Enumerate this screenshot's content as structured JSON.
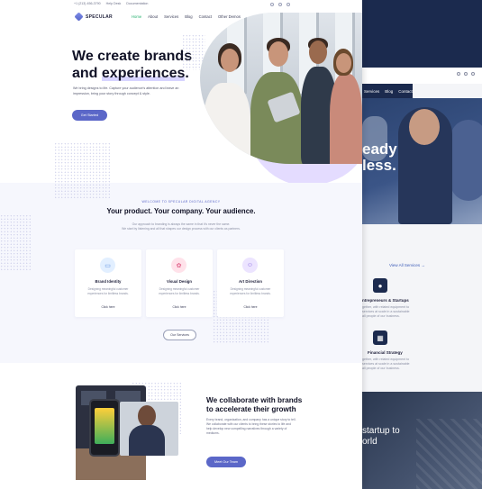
{
  "topbar": {
    "items": [
      "+1 (213) 456-3790",
      "Help Desk",
      "Documentation"
    ]
  },
  "brand": {
    "name": "SPECULAR"
  },
  "nav": {
    "items": [
      "Home",
      "About",
      "Services",
      "Blog",
      "Contact",
      "Other Demos"
    ],
    "active_index": 0
  },
  "hero": {
    "title_line1": "We create brands",
    "title_line2_prefix": "and ",
    "title_line2_underlined": "experiences",
    "title_line2_suffix": ".",
    "subtitle": "We bring designs to life. Capture your audience's attention and leave an impression, bring your story through concept & style.",
    "cta": "Get Started"
  },
  "services": {
    "eyebrow": "WELCOME TO SPECULAR DIGITAL AGENCY",
    "title": "Your product. Your company. Your audience.",
    "subtitle_line1": "Our approach to branding is always the same in that it's never the same.",
    "subtitle_line2": "We start by listening and all that shapes our design process with our clients as partners.",
    "cards": [
      {
        "icon": "monitor-icon",
        "title": "Brand Identity",
        "text": "Designing meaningful customer experiences for limitless brands.",
        "link": "Click here"
      },
      {
        "icon": "brush-icon",
        "title": "Visual Design",
        "text": "Designing meaningful customer experiences for limitless brands.",
        "link": "Click here"
      },
      {
        "icon": "smile-icon",
        "title": "Art Direction",
        "text": "Designing meaningful customer experiences for limitless brands.",
        "link": "Click here"
      }
    ],
    "cta": "Our Services"
  },
  "collab": {
    "title_line1": "We collaborate with brands",
    "title_line2": "to accelerate their growth",
    "text": "Every brand, organization, and company has a unique story to tell. We collaborate with our clients to bring these stories to life and help develop new compelling narratives through a variety of mediums.",
    "cta": "Meet Our Team"
  },
  "back_page": {
    "nav_items": [
      "Services",
      "Blog",
      "Contact"
    ],
    "hero_headline": "eady\nless.",
    "view_all": "View All Services  →",
    "features": [
      {
        "icon": "lightbulb-icon",
        "title": "ntrepreneurs & Startups",
        "text": "gether, with related equipment to\nservices at scale in a sustainable\nall people of our business."
      },
      {
        "icon": "money-icon",
        "title": "Financial Strategy",
        "text": "gether, with related equipment to\nservices at scale in a sustainable\nall people of our business."
      }
    ],
    "band_text": "startup to\norld"
  },
  "colors": {
    "accent": "#5b67c8",
    "active_nav": "#26b06f",
    "navy": "#1b2a4e",
    "blob": "#e4dcff"
  }
}
